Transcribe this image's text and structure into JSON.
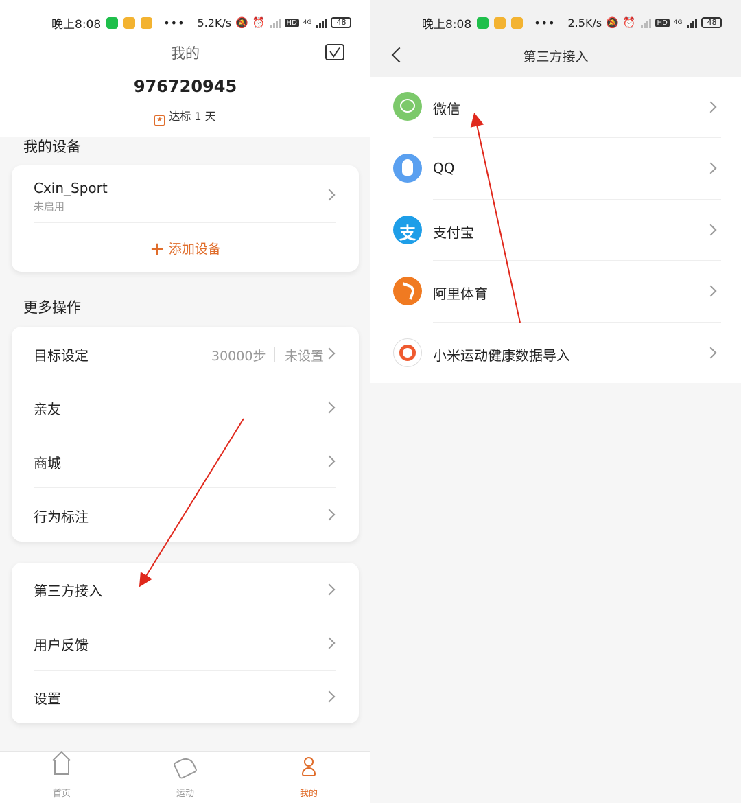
{
  "status_left": {
    "time": "晚上8:08",
    "dots": "•••",
    "speed": "5.2K/s",
    "network": "4G",
    "hd": "HD",
    "battery": "48"
  },
  "status_right": {
    "time": "晚上8:08",
    "dots": "•••",
    "speed": "2.5K/s",
    "network": "4G",
    "hd": "HD",
    "battery": "48"
  },
  "profile": {
    "page_title": "我的",
    "user_id": "976720945",
    "goal_badge": "达标 1 天"
  },
  "devices": {
    "section_title": "我的设备",
    "items": [
      {
        "name": "Cxin_Sport",
        "status": "未启用"
      }
    ],
    "add_label": "添加设备"
  },
  "more": {
    "section_title": "更多操作",
    "goal": {
      "label": "目标设定",
      "steps": "30000步",
      "status": "未设置"
    },
    "items": [
      {
        "label": "亲友"
      },
      {
        "label": "商城"
      },
      {
        "label": "行为标注"
      }
    ]
  },
  "settings_group": {
    "items": [
      {
        "label": "第三方接入"
      },
      {
        "label": "用户反馈"
      },
      {
        "label": "设置"
      }
    ]
  },
  "bottom_nav": {
    "items": [
      {
        "label": "首页",
        "icon": "home-icon"
      },
      {
        "label": "运动",
        "icon": "shoe-icon"
      },
      {
        "label": "我的",
        "icon": "person-icon",
        "active": true
      }
    ],
    "active_color": "#e06d2b"
  },
  "third_party": {
    "title": "第三方接入",
    "items": [
      {
        "label": "微信",
        "icon": "wechat-icon",
        "color": "#7cc96b"
      },
      {
        "label": "QQ",
        "icon": "qq-icon",
        "color": "#5aa0f0"
      },
      {
        "label": "支付宝",
        "icon": "alipay-icon",
        "color": "#1e9ee8"
      },
      {
        "label": "阿里体育",
        "icon": "ali-sports-icon",
        "color": "#f07a21"
      },
      {
        "label": "小米运动健康数据导入",
        "icon": "mi-health-icon",
        "color": "#ef5a2f"
      }
    ]
  },
  "accent_color": "#e06d2b",
  "annotation_color": "#e0281c"
}
